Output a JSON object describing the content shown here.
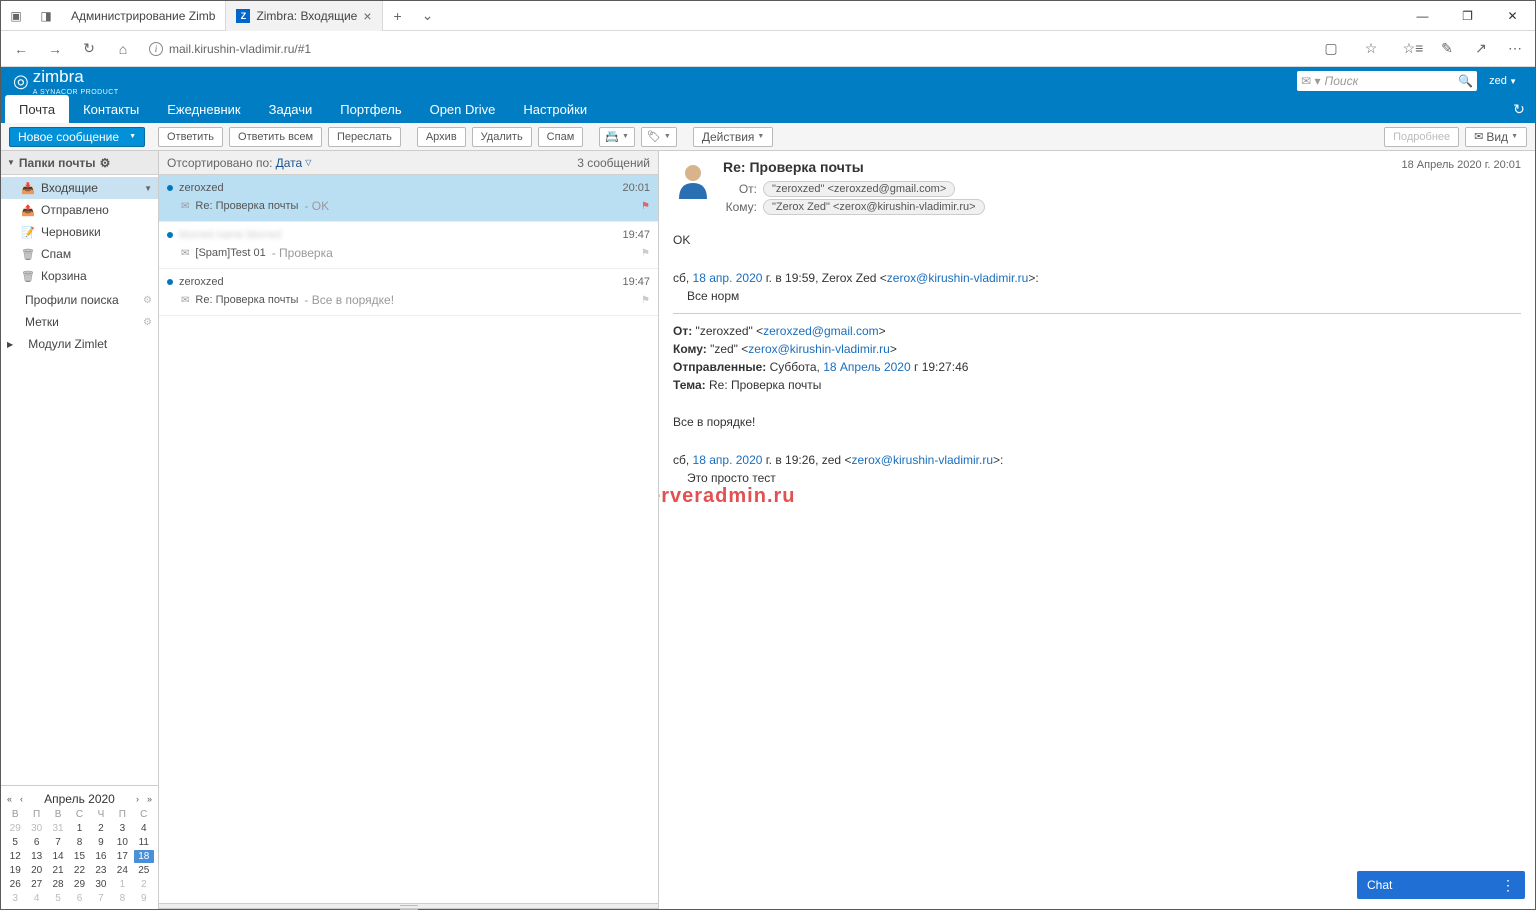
{
  "browser": {
    "tabs": [
      {
        "title": "Администрирование Zimb",
        "active": false,
        "icon": ""
      },
      {
        "title": "Zimbra: Входящие",
        "active": true,
        "icon": "Z"
      }
    ],
    "url": "mail.kirushin-vladimir.ru/#1"
  },
  "header": {
    "user": "zed",
    "search_placeholder": "Поиск"
  },
  "main_tabs": [
    "Почта",
    "Контакты",
    "Ежедневник",
    "Задачи",
    "Портфель",
    "Open Drive",
    "Настройки"
  ],
  "toolbar": {
    "new_message": "Новое сообщение",
    "reply": "Ответить",
    "reply_all": "Ответить всем",
    "forward": "Переслать",
    "archive": "Архив",
    "delete": "Удалить",
    "spam": "Спам",
    "actions": "Действия",
    "more": "Подробнее",
    "view": "Вид"
  },
  "nav": {
    "folders_header": "Папки почты",
    "inbox": "Входящие",
    "sent": "Отправлено",
    "drafts": "Черновики",
    "spam": "Спам",
    "trash": "Корзина",
    "search_profiles": "Профили поиска",
    "tags": "Метки",
    "zimlets": "Модули Zimlet"
  },
  "calendar": {
    "month": "Апрель 2020",
    "weekdays": [
      "В",
      "П",
      "В",
      "С",
      "Ч",
      "П",
      "С"
    ],
    "rows": [
      [
        "29",
        "30",
        "31",
        "1",
        "2",
        "3",
        "4"
      ],
      [
        "5",
        "6",
        "7",
        "8",
        "9",
        "10",
        "11"
      ],
      [
        "12",
        "13",
        "14",
        "15",
        "16",
        "17",
        "18"
      ],
      [
        "19",
        "20",
        "21",
        "22",
        "23",
        "24",
        "25"
      ],
      [
        "26",
        "27",
        "28",
        "29",
        "30",
        "1",
        "2"
      ],
      [
        "3",
        "4",
        "5",
        "6",
        "7",
        "8",
        "9"
      ]
    ],
    "today": "18",
    "other_month_before": 3,
    "other_month_after": 9
  },
  "list": {
    "sort_label": "Отсортировано по:",
    "sort_field": "Дата",
    "count": "3 сообщений",
    "threads": [
      {
        "sender": "zeroxzed",
        "time": "20:01",
        "selected": true,
        "unread": true,
        "subject": "Re: Проверка почты",
        "snippet": "OK",
        "flag": "red"
      },
      {
        "sender": "blurred name blurred",
        "time": "19:47",
        "selected": false,
        "unread": true,
        "blurred_sender": true,
        "subject": "[Spam]Test 01",
        "snippet": "Проверка",
        "flag": ""
      },
      {
        "sender": "zeroxzed",
        "time": "19:47",
        "selected": false,
        "unread": true,
        "subject": "Re: Проверка почты",
        "snippet": "Все в порядке!",
        "flag": ""
      }
    ]
  },
  "reader": {
    "title": "Re: Проверка почты",
    "date": "18 Апрель 2020 г. 20:01",
    "from_label": "От:",
    "from": "\"zeroxzed\" <zeroxzed@gmail.com>",
    "to_label": "Кому:",
    "to": "\"Zerox Zed\" <zerox@kirushin-vladimir.ru>",
    "body_line1": "OK",
    "quote_intro_prefix": "сб, ",
    "quote_intro_date": "18 апр. 2020",
    "quote_intro_mid": " г. в 19:59, Zerox Zed <",
    "quote_intro_email": "zerox@kirushin-vladimir.ru",
    "quote_intro_suffix": ">:",
    "quote_body": "Все норм",
    "orig_from_label": "От:",
    "orig_from_name": " \"zeroxzed\" <",
    "orig_from_email": "zeroxzed@gmail.com",
    "orig_from_close": ">",
    "orig_to_label": "Кому:",
    "orig_to_name": " \"zed\" <",
    "orig_to_email": "zerox@kirushin-vladimir.ru",
    "orig_to_close": ">",
    "orig_sent_label": "Отправленные:",
    "orig_sent": " Суббота, ",
    "orig_sent_date": "18 Апрель 2020",
    "orig_sent_time": " г 19:27:46",
    "orig_subj_label": "Тема:",
    "orig_subj": " Re: Проверка почты",
    "orig_body": "Все в порядке!",
    "deep_intro_prefix": "сб, ",
    "deep_intro_date": "18 апр. 2020",
    "deep_intro_mid": " г. в 19:26, zed <",
    "deep_intro_email": "zerox@kirushin-vladimir.ru",
    "deep_intro_suffix": ">:",
    "deep_body": "Это просто тест"
  },
  "chat": {
    "label": "Chat"
  }
}
